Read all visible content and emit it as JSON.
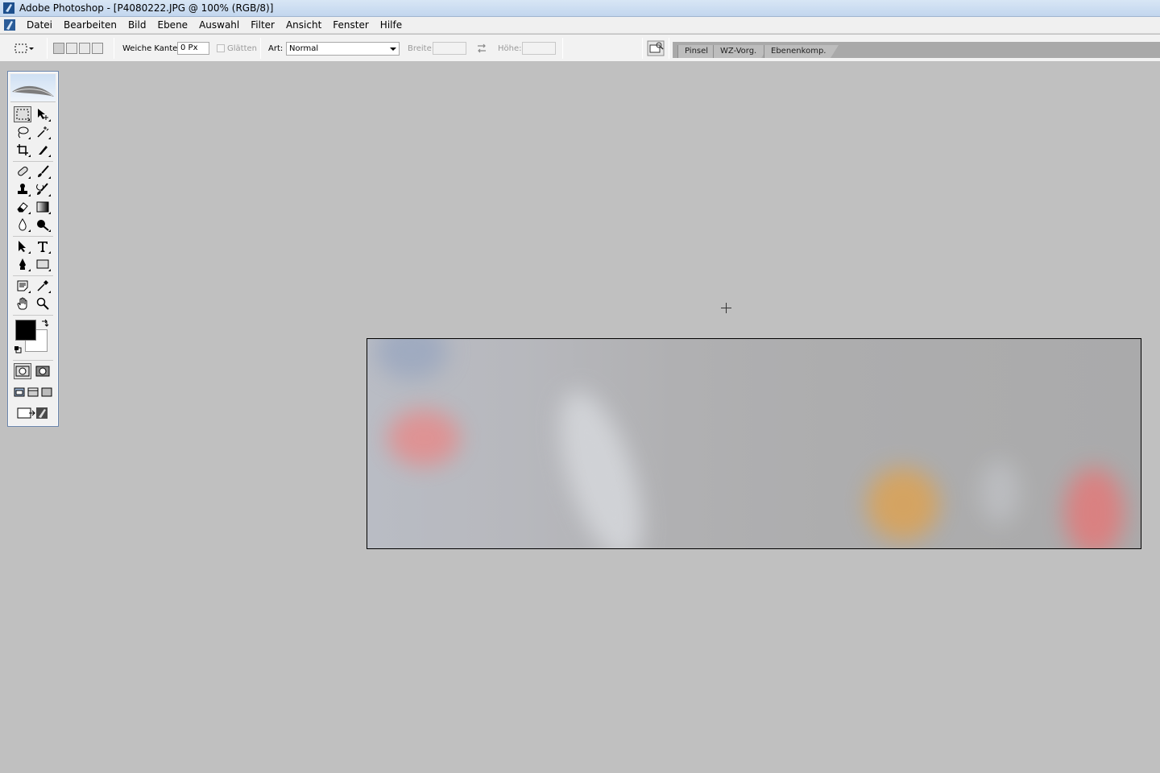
{
  "window": {
    "title": "Adobe Photoshop - [P4080222.JPG @ 100% (RGB/8)]"
  },
  "menu": {
    "items": [
      "Datei",
      "Bearbeiten",
      "Bild",
      "Ebene",
      "Auswahl",
      "Filter",
      "Ansicht",
      "Fenster",
      "Hilfe"
    ]
  },
  "options": {
    "feather_label": "Weiche Kante:",
    "feather_value": "0 Px",
    "antialias_label": "Glätten",
    "style_label": "Art:",
    "style_value": "Normal",
    "width_label": "Breite:",
    "width_value": "",
    "height_label": "Höhe:",
    "height_value": ""
  },
  "palette_well": {
    "tabs": [
      "Pinsel",
      "WZ-Vorg.",
      "Ebenenkomp."
    ]
  },
  "toolbox": {
    "tools": [
      "rectangular-marquee",
      "move",
      "lasso",
      "magic-wand",
      "crop",
      "slice",
      "healing-brush",
      "brush",
      "clone-stamp",
      "history-brush",
      "eraser",
      "gradient",
      "blur",
      "dodge",
      "path-selection",
      "type",
      "pen",
      "rectangle-shape",
      "notes",
      "eyedropper",
      "hand",
      "zoom"
    ],
    "active_tool": "rectangular-marquee",
    "foreground_color": "#000000",
    "background_color": "#ffffff"
  },
  "document": {
    "filename": "P4080222.JPG",
    "zoom": "100%",
    "mode": "RGB/8"
  }
}
